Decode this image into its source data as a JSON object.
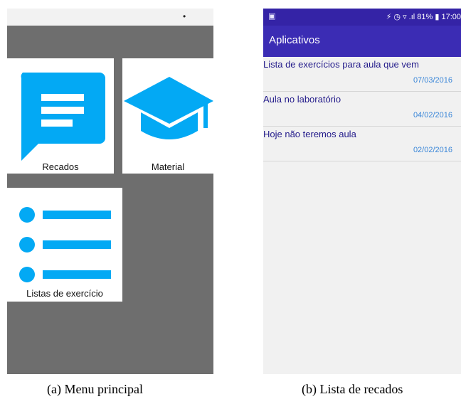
{
  "menu_screen": {
    "status_bar": {
      "time": "17:00",
      "battery": "81%"
    },
    "tiles": [
      {
        "label": "Recados",
        "icon": "message-icon"
      },
      {
        "label": "Material",
        "icon": "graduation-cap-icon"
      },
      {
        "label": "Listas de exercício",
        "icon": "list-icon"
      }
    ],
    "colors": {
      "background": "#6e6e6e",
      "tile": "#ffffff",
      "icon": "#03a9f4"
    }
  },
  "messages_screen": {
    "status_bar": {
      "text": "⚡ ◷ ▿ .ıl 81% ▮ 17:00"
    },
    "app_title": "Aplicativos",
    "messages": [
      {
        "title": "Lista de exercícios para aula que vem",
        "date": "07/03/2016"
      },
      {
        "title": "Aula no laboratório",
        "date": "04/02/2016"
      },
      {
        "title": "Hoje não teremos aula",
        "date": "02/02/2016"
      }
    ],
    "colors": {
      "appbar": "#3b2cb4",
      "title_text": "#221a8a",
      "date_text": "#3a86d8"
    }
  },
  "captions": {
    "a": "(a) Menu principal",
    "b": "(b) Lista de recados"
  }
}
